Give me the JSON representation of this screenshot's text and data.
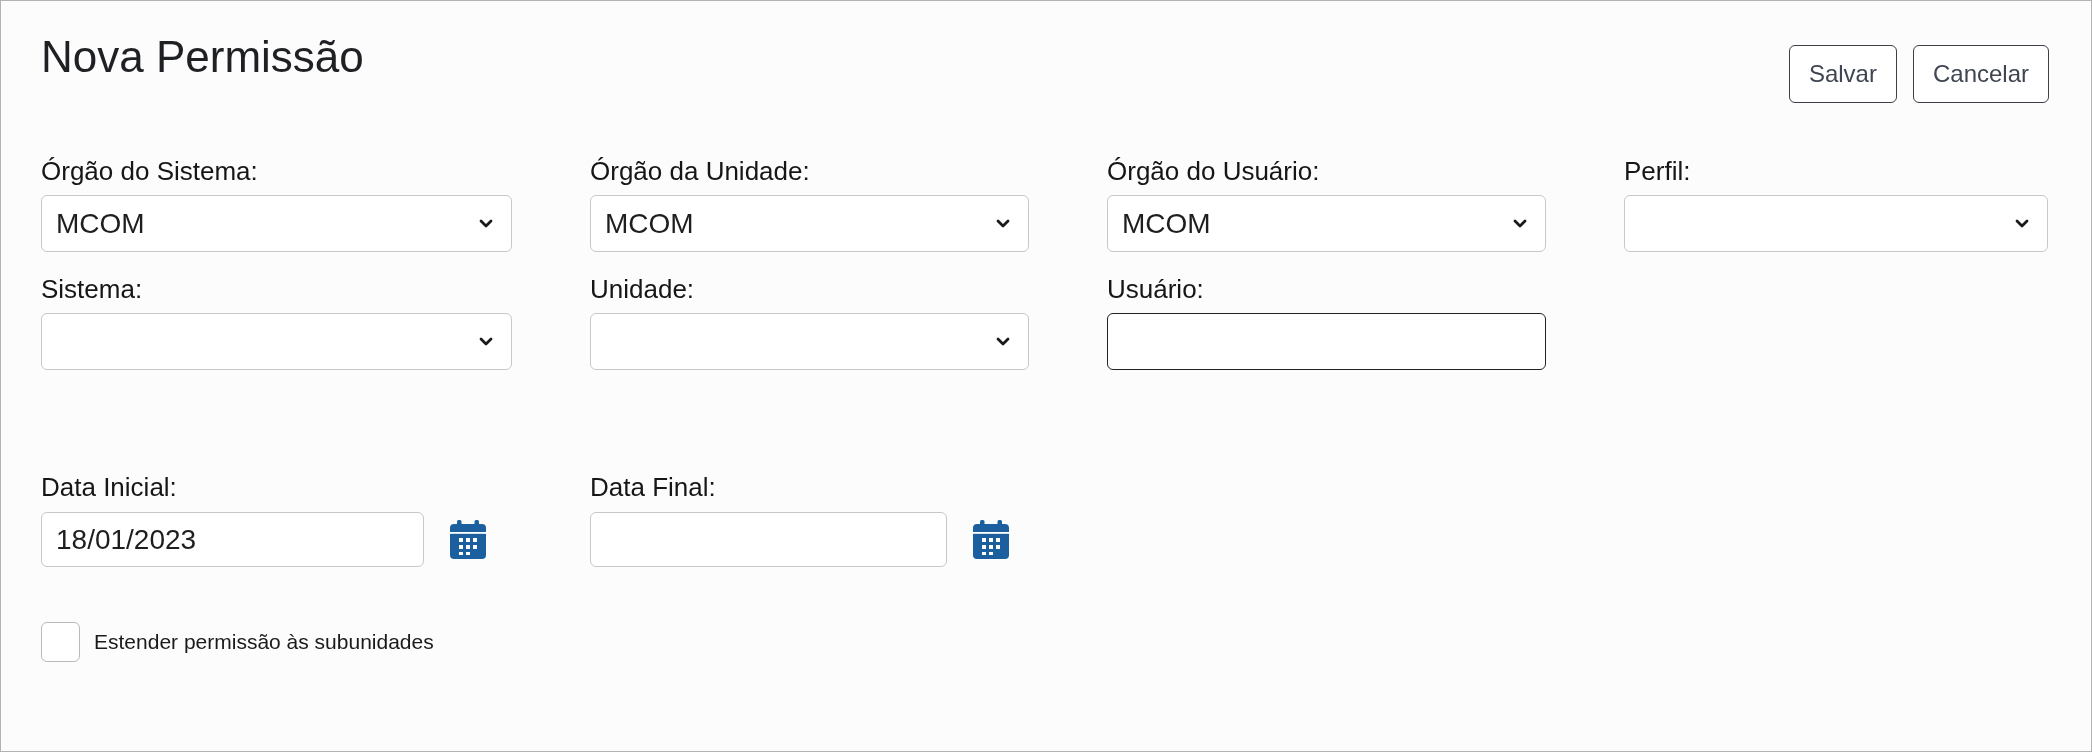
{
  "title": "Nova Permissão",
  "buttons": [
    {
      "label": "Salvar"
    },
    {
      "label": "Cancelar"
    }
  ],
  "fields": [
    {
      "label": "Órgão do Sistema:",
      "kind": "select",
      "value": "MCOM",
      "focused": false
    },
    {
      "label": "Órgão da Unidade:",
      "kind": "select",
      "value": "MCOM",
      "focused": false
    },
    {
      "label": "Órgão do Usuário:",
      "kind": "select",
      "value": "MCOM",
      "focused": false
    },
    {
      "label": "Perfil:",
      "kind": "select",
      "focused": false
    },
    {
      "label": "Sistema:",
      "kind": "select",
      "focused": false
    },
    {
      "label": "Unidade:",
      "kind": "select",
      "focused": false
    },
    {
      "label": "Usuário:",
      "kind": "text",
      "focused": true
    }
  ],
  "date_fields": [
    {
      "label": "Data Inicial:",
      "value": "18/01/2023"
    },
    {
      "label": "Data Final:"
    }
  ],
  "checkbox": {
    "label": "Estender permissão às subunidades",
    "checked": false
  }
}
